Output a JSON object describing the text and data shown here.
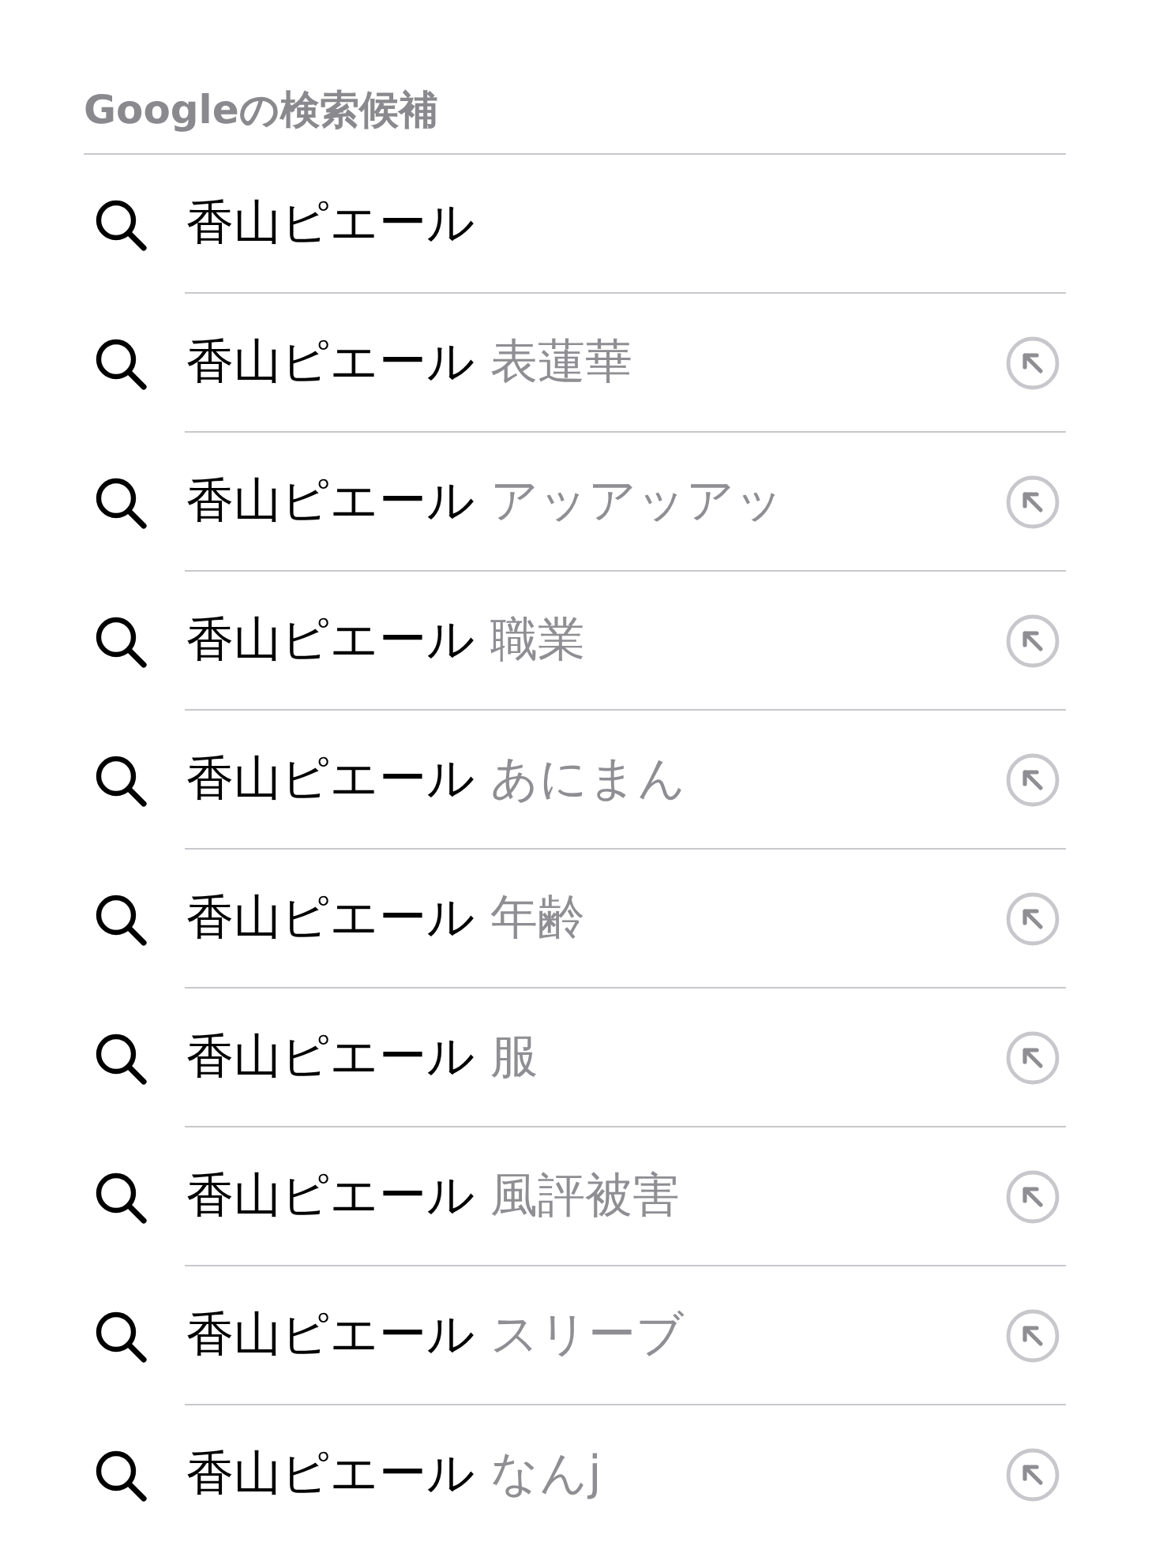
{
  "header": {
    "title": "Googleの検索候補"
  },
  "suggestions": [
    {
      "query": "香山ピエール",
      "fill_button": false
    },
    {
      "query": "香山ピエール",
      "completion": "表蓮華",
      "fill_button": true
    },
    {
      "query": "香山ピエール",
      "completion": "アッアッアッ",
      "fill_button": true
    },
    {
      "query": "香山ピエール",
      "completion": "職業",
      "fill_button": true
    },
    {
      "query": "香山ピエール",
      "completion": "あにまん",
      "fill_button": true
    },
    {
      "query": "香山ピエール",
      "completion": "年齢",
      "fill_button": true
    },
    {
      "query": "香山ピエール",
      "completion": "服",
      "fill_button": true
    },
    {
      "query": "香山ピエール",
      "completion": "風評被害",
      "fill_button": true
    },
    {
      "query": "香山ピエール",
      "completion": "スリーブ",
      "fill_button": true
    },
    {
      "query": "香山ピエール",
      "completion": "なんj",
      "fill_button": true
    }
  ]
}
